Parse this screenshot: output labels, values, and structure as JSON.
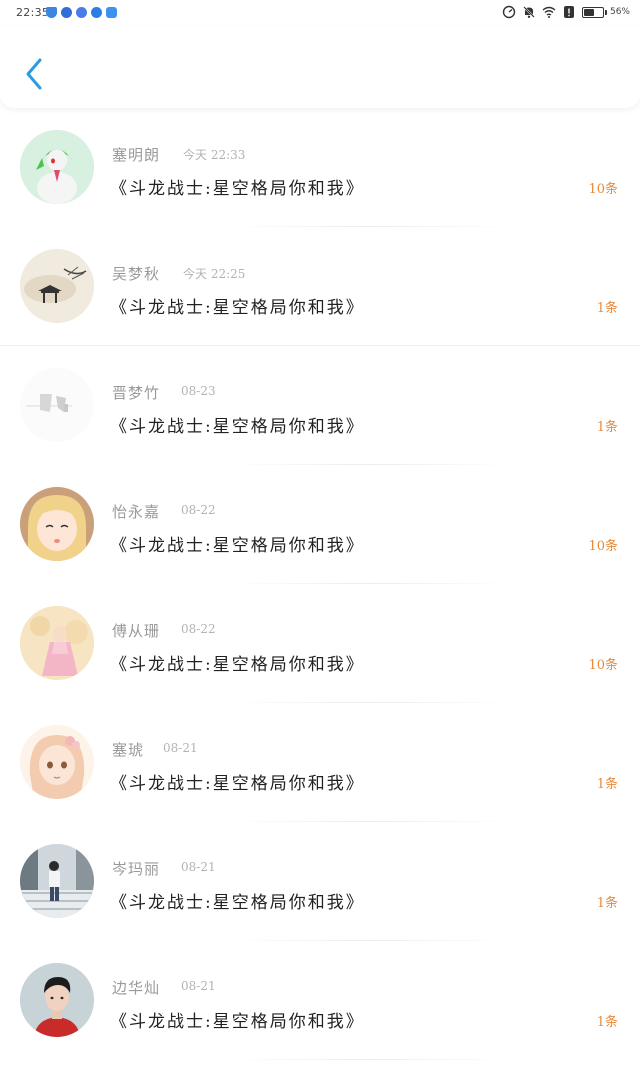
{
  "status_bar": {
    "time": "22:35",
    "battery_level": "56%",
    "battery_fraction": 0.56,
    "left_icons": [
      "shield-icon",
      "browser-icon",
      "music-icon",
      "message-icon",
      "cloud-icon"
    ],
    "right_icons": [
      "speed-icon",
      "mute-icon",
      "wifi-icon",
      "alert-icon",
      "battery-icon"
    ]
  },
  "header": {
    "back_icon": "chevron-left-icon",
    "accent_color": "#2b9be6"
  },
  "items": [
    {
      "name": "塞明朗",
      "time": "今天 22:33",
      "title": "《斗龙战士:星空格局你和我》",
      "count": "10条",
      "avatar": "gardevoir-avatar"
    },
    {
      "name": "吴梦秋",
      "time": "今天 22:25",
      "title": "《斗龙战士:星空格局你和我》",
      "count": "1条",
      "avatar": "ink-painting-avatar"
    },
    {
      "name": "晋梦竹",
      "time": "08-23",
      "title": "《斗龙战士:星空格局你和我》",
      "count": "1条",
      "avatar": "faded-avatar"
    },
    {
      "name": "怡永嘉",
      "time": "08-22",
      "title": "《斗龙战士:星空格局你和我》",
      "count": "10条",
      "avatar": "anime-girl-avatar"
    },
    {
      "name": "傅从珊",
      "time": "08-22",
      "title": "《斗龙战士:星空格局你和我》",
      "count": "10条",
      "avatar": "pink-dress-avatar"
    },
    {
      "name": "塞琥",
      "time": "08-21",
      "title": "《斗龙战士:星空格局你和我》",
      "count": "1条",
      "avatar": "anime-portrait-avatar"
    },
    {
      "name": "岑玛丽",
      "time": "08-21",
      "title": "《斗龙战士:星空格局你和我》",
      "count": "1条",
      "avatar": "street-photo-avatar"
    },
    {
      "name": "边华灿",
      "time": "08-21",
      "title": "《斗龙战士:星空格局你和我》",
      "count": "1条",
      "avatar": "boy-avatar"
    }
  ],
  "colors": {
    "count": "#e68a3c",
    "name": "#9a9a9a",
    "title": "#222222"
  }
}
